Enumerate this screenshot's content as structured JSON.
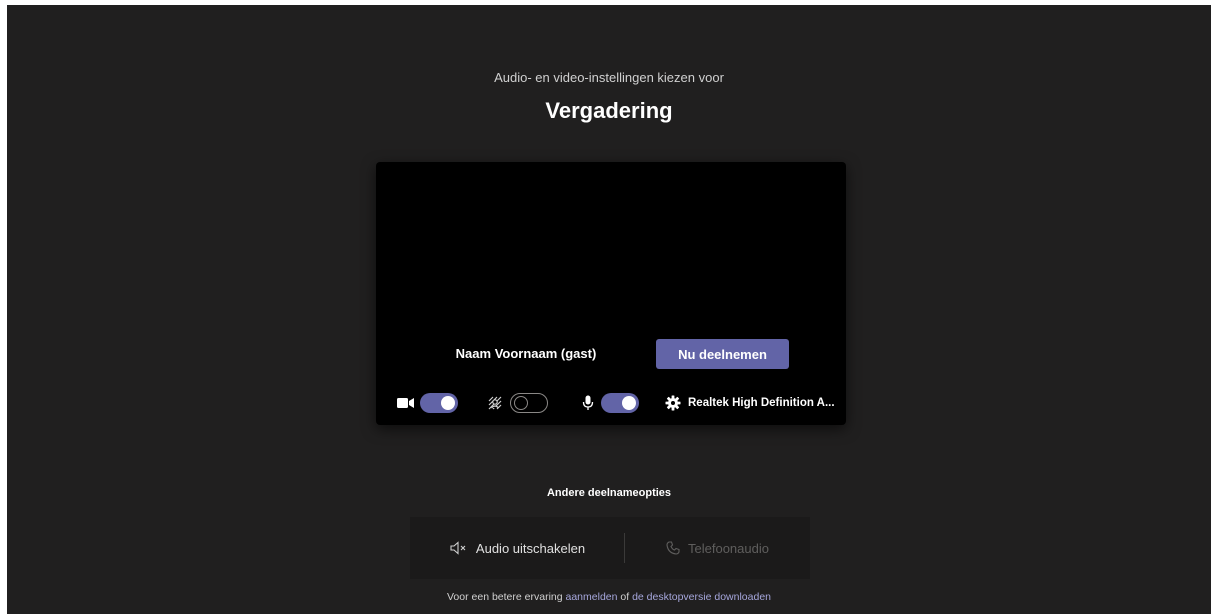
{
  "header": {
    "subtitle": "Audio- en video-instellingen kiezen voor",
    "meeting_title": "Vergadering"
  },
  "preview": {
    "display_name": "Naam Voornaam (gast)",
    "join_button": "Nu deelnemen",
    "controls": {
      "camera": {
        "icon": "video-camera-icon",
        "state": "on"
      },
      "background_blur": {
        "icon": "background-blur-icon",
        "state": "off"
      },
      "microphone": {
        "icon": "microphone-icon",
        "state": "on"
      },
      "device_settings_icon": "gear-icon",
      "audio_device": "Realtek High Definition A..."
    }
  },
  "other_options": {
    "title": "Andere deelnameopties",
    "audio_off": "Audio uitschakelen",
    "phone_audio": "Telefoonaudio"
  },
  "footer": {
    "prefix": "Voor een betere ervaring ",
    "signin_link": "aanmelden",
    "middle": " of ",
    "download_link": "de desktopversie downloaden"
  },
  "colors": {
    "background": "#201f1f",
    "accent": "#6264a7",
    "link": "#a6a7dc"
  }
}
